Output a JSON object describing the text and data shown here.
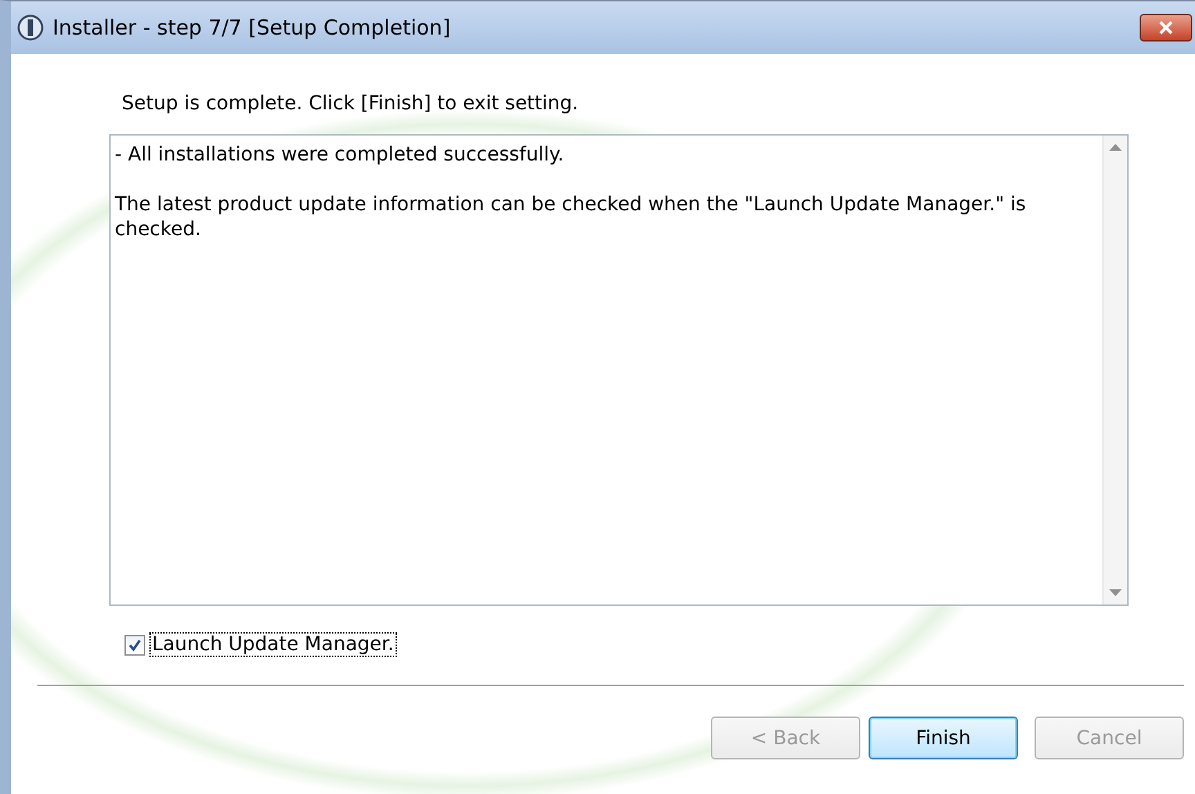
{
  "window": {
    "title": "Installer - step 7/7 [Setup Completion]"
  },
  "instruction": "Setup is complete. Click [Finish] to exit setting.",
  "log": {
    "paragraphs": [
      "- All installations were completed successfully.",
      "The latest product update information can be checked when the \"Launch Update Manager.\" is checked."
    ]
  },
  "checkbox": {
    "label": "Launch Update Manager.",
    "checked": true
  },
  "buttons": [
    {
      "label": "< Back",
      "disabled": true,
      "default": false
    },
    {
      "label": "Finish",
      "disabled": false,
      "default": true
    },
    {
      "label": "Cancel",
      "disabled": true,
      "default": false
    }
  ]
}
